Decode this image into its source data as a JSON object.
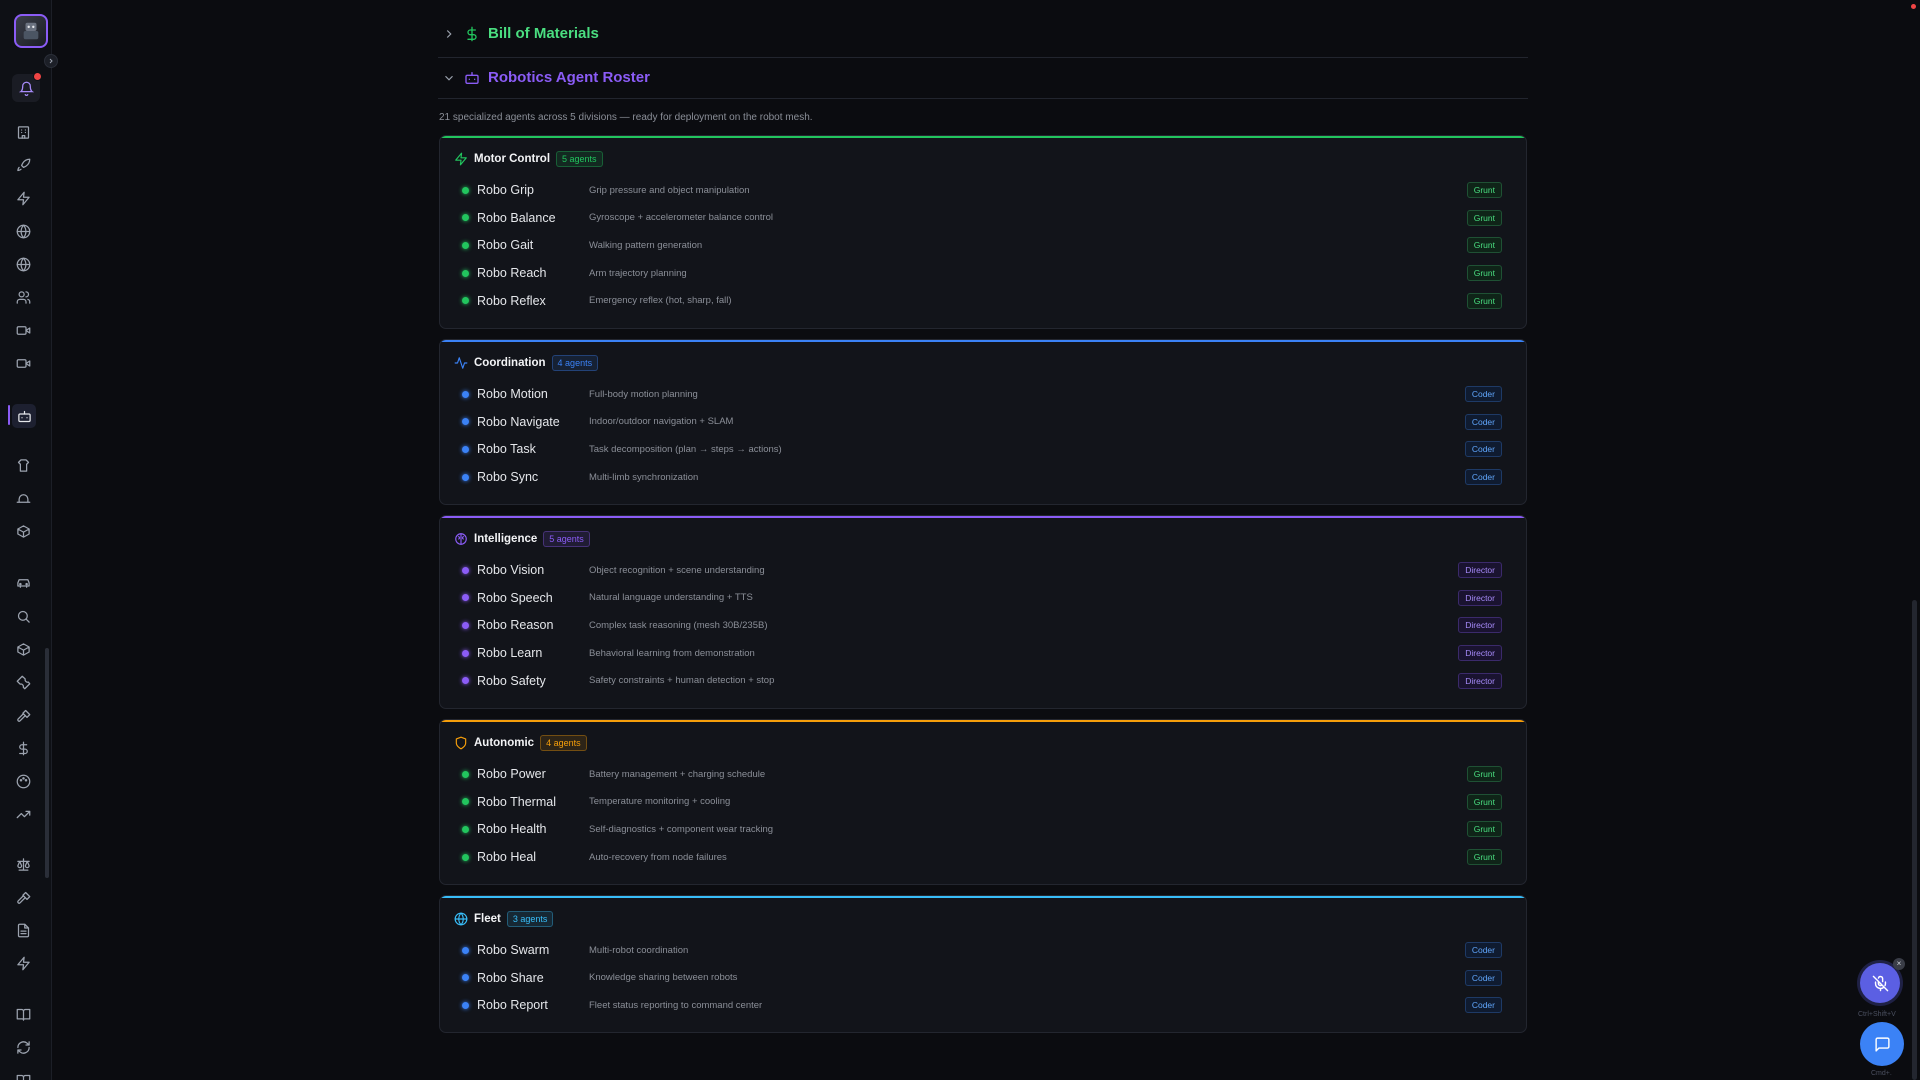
{
  "sidebar": {
    "icons": [
      "building-icon",
      "rocket-icon",
      "zap-icon",
      "globe-icon",
      "globe-2-icon",
      "users-icon",
      "video-icon",
      "video-2-icon",
      "bot-icon",
      "shirt-icon",
      "hat-icon",
      "box-icon",
      "car-icon",
      "search-icon",
      "package-icon",
      "wrench-icon",
      "hammer-icon",
      "dollar-icon",
      "palette-icon",
      "trending-icon",
      "scale-icon",
      "gavel-icon",
      "file-icon",
      "bolt-icon",
      "book-icon",
      "refresh-icon",
      "book-open-icon"
    ]
  },
  "sections": {
    "bom": {
      "title": "Bill of Materials",
      "color": "#22c55e",
      "expanded": false
    },
    "roster": {
      "title": "Robotics Agent Roster",
      "color": "#8b5cf6",
      "expanded": true,
      "intro": "21 specialized agents across 5 divisions — ready for deployment on the robot mesh."
    }
  },
  "divisions": [
    {
      "name": "Motor Control",
      "count_label": "5 agents",
      "accent": "#22c55e",
      "icon": "zap-icon",
      "agents": [
        {
          "name": "Robo Grip",
          "desc": "Grip pressure and object manipulation",
          "role": "Grunt"
        },
        {
          "name": "Robo Balance",
          "desc": "Gyroscope + accelerometer balance control",
          "role": "Grunt"
        },
        {
          "name": "Robo Gait",
          "desc": "Walking pattern generation",
          "role": "Grunt"
        },
        {
          "name": "Robo Reach",
          "desc": "Arm trajectory planning",
          "role": "Grunt"
        },
        {
          "name": "Robo Reflex",
          "desc": "Emergency reflex (hot, sharp, fall)",
          "role": "Grunt"
        }
      ]
    },
    {
      "name": "Coordination",
      "count_label": "4 agents",
      "accent": "#3b82f6",
      "icon": "activity-icon",
      "agents": [
        {
          "name": "Robo Motion",
          "desc": "Full-body motion planning",
          "role": "Coder"
        },
        {
          "name": "Robo Navigate",
          "desc": "Indoor/outdoor navigation + SLAM",
          "role": "Coder"
        },
        {
          "name": "Robo Task",
          "desc": "Task decomposition (plan → steps → actions)",
          "role": "Coder"
        },
        {
          "name": "Robo Sync",
          "desc": "Multi-limb synchronization",
          "role": "Coder"
        }
      ]
    },
    {
      "name": "Intelligence",
      "count_label": "5 agents",
      "accent": "#8b5cf6",
      "icon": "brain-icon",
      "agents": [
        {
          "name": "Robo Vision",
          "desc": "Object recognition + scene understanding",
          "role": "Director"
        },
        {
          "name": "Robo Speech",
          "desc": "Natural language understanding + TTS",
          "role": "Director"
        },
        {
          "name": "Robo Reason",
          "desc": "Complex task reasoning (mesh 30B/235B)",
          "role": "Director"
        },
        {
          "name": "Robo Learn",
          "desc": "Behavioral learning from demonstration",
          "role": "Director"
        },
        {
          "name": "Robo Safety",
          "desc": "Safety constraints + human detection + stop",
          "role": "Director"
        }
      ]
    },
    {
      "name": "Autonomic",
      "count_label": "4 agents",
      "accent": "#f59e0b",
      "icon": "shield-icon",
      "agents": [
        {
          "name": "Robo Power",
          "desc": "Battery management + charging schedule",
          "role": "Grunt"
        },
        {
          "name": "Robo Thermal",
          "desc": "Temperature monitoring + cooling",
          "role": "Grunt"
        },
        {
          "name": "Robo Health",
          "desc": "Self-diagnostics + component wear tracking",
          "role": "Grunt"
        },
        {
          "name": "Robo Heal",
          "desc": "Auto-recovery from node failures",
          "role": "Grunt"
        }
      ]
    },
    {
      "name": "Fleet",
      "count_label": "3 agents",
      "accent": "#38bdf8",
      "icon": "globe-icon",
      "agents": [
        {
          "name": "Robo Swarm",
          "desc": "Multi-robot coordination",
          "role": "Coder"
        },
        {
          "name": "Robo Share",
          "desc": "Knowledge sharing between robots",
          "role": "Coder"
        },
        {
          "name": "Robo Report",
          "desc": "Fleet status reporting to command center",
          "role": "Coder"
        }
      ]
    }
  ],
  "role_colors": {
    "Grunt": {
      "fg": "#4ade80",
      "bg": "#0f2418",
      "border": "#1f5134",
      "dot": "#22c55e"
    },
    "Coder": {
      "fg": "#60a5fa",
      "bg": "#0f1b30",
      "border": "#1e3a66",
      "dot": "#3b82f6"
    },
    "Director": {
      "fg": "#a78bfa",
      "bg": "#1a1330",
      "border": "#3b2a6b",
      "dot": "#8b5cf6"
    }
  },
  "fab": {
    "mic_hint": "Ctrl+Shift+V",
    "chat_hint": "Cmd+."
  }
}
